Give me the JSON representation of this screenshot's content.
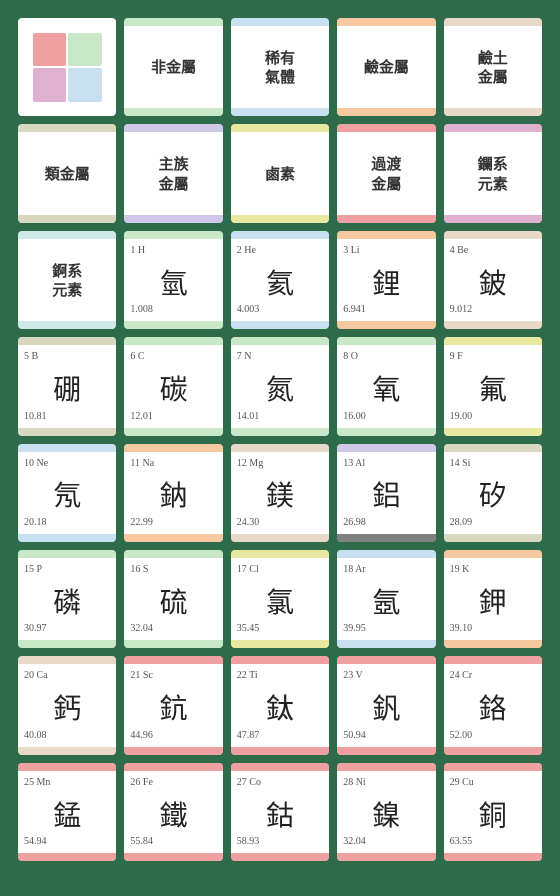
{
  "rows": [
    {
      "type": "legend-row",
      "cells": [
        {
          "type": "legend"
        },
        {
          "type": "category",
          "label": "非金屬",
          "topColor": "#c8e8c8",
          "bottomColor": "#c8e8c8"
        },
        {
          "type": "category",
          "label": "稀有\n氣體",
          "topColor": "#c8e0f0",
          "bottomColor": "#c8e0f0"
        },
        {
          "type": "category",
          "label": "鹼金屬",
          "topColor": "#f5c8a0",
          "bottomColor": "#f5c8a0"
        },
        {
          "type": "category",
          "label": "鹼土\n金屬",
          "topColor": "#e8d8c8",
          "bottomColor": "#e8d8c8"
        }
      ]
    },
    {
      "type": "category-row",
      "cells": [
        {
          "type": "category",
          "label": "類金屬",
          "topColor": "#d8d8c0",
          "bottomColor": "#d8d8c0"
        },
        {
          "type": "category",
          "label": "主族\n金屬",
          "topColor": "#d0c8e8",
          "bottomColor": "#d0c8e8"
        },
        {
          "type": "category",
          "label": "鹵素",
          "topColor": "#e8e8a0",
          "bottomColor": "#e8e8a0"
        },
        {
          "type": "category",
          "label": "過渡\n金屬",
          "topColor": "#f0a0a0",
          "bottomColor": "#f0a0a0"
        },
        {
          "type": "category",
          "label": "鑭系\n元素",
          "topColor": "#e0b0d0",
          "bottomColor": "#e0b0d0"
        }
      ]
    },
    {
      "type": "element-row",
      "cells": [
        {
          "type": "category",
          "label": "錒系\n元素",
          "topColor": "#d0e8e8",
          "bottomColor": "#d0e8e8"
        },
        {
          "type": "element",
          "number": "1",
          "symbol": "H",
          "kanji": "氫",
          "weight": "1.008",
          "topColor": "#c8e8c8",
          "bottomColor": "#c8e8c8"
        },
        {
          "type": "element",
          "number": "2",
          "symbol": "He",
          "kanji": "氦",
          "weight": "4.003",
          "topColor": "#c8e0f0",
          "bottomColor": "#c8e0f0"
        },
        {
          "type": "element",
          "number": "3",
          "symbol": "Li",
          "kanji": "鋰",
          "weight": "6.941",
          "topColor": "#f5c8a0",
          "bottomColor": "#f5c8a0"
        },
        {
          "type": "element",
          "number": "4",
          "symbol": "Be",
          "kanji": "鈹",
          "weight": "9.012",
          "topColor": "#e8d8c8",
          "bottomColor": "#e8d8c8"
        }
      ]
    },
    {
      "type": "element-row",
      "cells": [
        {
          "type": "element",
          "number": "5",
          "symbol": "B",
          "kanji": "硼",
          "weight": "10.81",
          "topColor": "#d8d8c0",
          "bottomColor": "#d8d8c0"
        },
        {
          "type": "element",
          "number": "6",
          "symbol": "C",
          "kanji": "碳",
          "weight": "12.01",
          "topColor": "#c8e8c8",
          "bottomColor": "#c8e8c8"
        },
        {
          "type": "element",
          "number": "7",
          "symbol": "N",
          "kanji": "氮",
          "weight": "14.01",
          "topColor": "#c8e8c8",
          "bottomColor": "#c8e8c8"
        },
        {
          "type": "element",
          "number": "8",
          "symbol": "O",
          "kanji": "氧",
          "weight": "16.00",
          "topColor": "#c8e8c8",
          "bottomColor": "#c8e8c8"
        },
        {
          "type": "element",
          "number": "9",
          "symbol": "F",
          "kanji": "氟",
          "weight": "19.00",
          "topColor": "#e8e8a0",
          "bottomColor": "#e8e8a0"
        }
      ]
    },
    {
      "type": "element-row",
      "cells": [
        {
          "type": "element",
          "number": "10",
          "symbol": "Ne",
          "kanji": "氖",
          "weight": "20.18",
          "topColor": "#c8e0f0",
          "bottomColor": "#c8e0f0"
        },
        {
          "type": "element",
          "number": "11",
          "symbol": "Na",
          "kanji": "鈉",
          "weight": "22.99",
          "topColor": "#f5c8a0",
          "bottomColor": "#f5c8a0"
        },
        {
          "type": "element",
          "number": "12",
          "symbol": "Mg",
          "kanji": "鎂",
          "weight": "24.30",
          "topColor": "#e8d8c8",
          "bottomColor": "#e8d8c8"
        },
        {
          "type": "element",
          "number": "13",
          "symbol": "Al",
          "kanji": "鋁",
          "weight": "26.98",
          "topColor": "#d0c8e8",
          "bottomColor": "#808080"
        },
        {
          "type": "element",
          "number": "14",
          "symbol": "Si",
          "kanji": "矽",
          "weight": "28.09",
          "topColor": "#d8d8c0",
          "bottomColor": "#d8d8c0"
        }
      ]
    },
    {
      "type": "element-row",
      "cells": [
        {
          "type": "element",
          "number": "15",
          "symbol": "P",
          "kanji": "磷",
          "weight": "30.97",
          "topColor": "#c8e8c8",
          "bottomColor": "#c8e8c8"
        },
        {
          "type": "element",
          "number": "16",
          "symbol": "S",
          "kanji": "硫",
          "weight": "32.04",
          "topColor": "#c8e8c8",
          "bottomColor": "#c8e8c8"
        },
        {
          "type": "element",
          "number": "17",
          "symbol": "Cl",
          "kanji": "氯",
          "weight": "35.45",
          "topColor": "#e8e8a0",
          "bottomColor": "#e8e8a0"
        },
        {
          "type": "element",
          "number": "18",
          "symbol": "Ar",
          "kanji": "氬",
          "weight": "39.95",
          "topColor": "#c8e0f0",
          "bottomColor": "#c8e0f0"
        },
        {
          "type": "element",
          "number": "19",
          "symbol": "K",
          "kanji": "鉀",
          "weight": "39.10",
          "topColor": "#f5c8a0",
          "bottomColor": "#f5c8a0"
        }
      ]
    },
    {
      "type": "element-row",
      "cells": [
        {
          "type": "element",
          "number": "20",
          "symbol": "Ca",
          "kanji": "鈣",
          "weight": "40.08",
          "topColor": "#e8d8c8",
          "bottomColor": "#e8d8c8"
        },
        {
          "type": "element",
          "number": "21",
          "symbol": "Sc",
          "kanji": "鈧",
          "weight": "44.96",
          "topColor": "#f0a0a0",
          "bottomColor": "#f0a0a0"
        },
        {
          "type": "element",
          "number": "22",
          "symbol": "Ti",
          "kanji": "鈦",
          "weight": "47.87",
          "topColor": "#f0a0a0",
          "bottomColor": "#f0a0a0"
        },
        {
          "type": "element",
          "number": "23",
          "symbol": "V",
          "kanji": "釩",
          "weight": "50.94",
          "topColor": "#f0a0a0",
          "bottomColor": "#f0a0a0"
        },
        {
          "type": "element",
          "number": "24",
          "symbol": "Cr",
          "kanji": "鉻",
          "weight": "52.00",
          "topColor": "#f0a0a0",
          "bottomColor": "#f0a0a0"
        }
      ]
    },
    {
      "type": "element-row",
      "cells": [
        {
          "type": "element",
          "number": "25",
          "symbol": "Mn",
          "kanji": "錳",
          "weight": "54.94",
          "topColor": "#f0a0a0",
          "bottomColor": "#f0a0a0"
        },
        {
          "type": "element",
          "number": "26",
          "symbol": "Fe",
          "kanji": "鐵",
          "weight": "55.84",
          "topColor": "#f0a0a0",
          "bottomColor": "#f0a0a0"
        },
        {
          "type": "element",
          "number": "27",
          "symbol": "Co",
          "kanji": "鈷",
          "weight": "58.93",
          "topColor": "#f0a0a0",
          "bottomColor": "#f0a0a0"
        },
        {
          "type": "element",
          "number": "28",
          "symbol": "Ni",
          "kanji": "鎳",
          "weight": "32.04",
          "topColor": "#f0a0a0",
          "bottomColor": "#f0a0a0"
        },
        {
          "type": "element",
          "number": "29",
          "symbol": "Cu",
          "kanji": "銅",
          "weight": "63.55",
          "topColor": "#f0a0a0",
          "bottomColor": "#f0a0a0"
        }
      ]
    }
  ]
}
